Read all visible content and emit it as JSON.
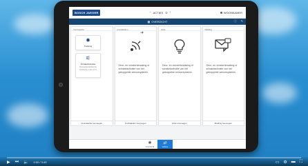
{
  "app": {
    "logo": "BOSCH JAEGER",
    "nav_title": "ACTIES",
    "nav_badge": "②",
    "user": "WOONKAMER"
  },
  "header": {
    "title": "OVERZICHT"
  },
  "columns": [
    {
      "head": "Voorwaarde",
      "tile1_label": "Trekking",
      "tile2_label": "Schakelactivatie",
      "tile2_sub": "Bewegingsactiviteit bij lichtsterkte onder 10 lx"
    },
    {
      "head": "Inschakelen",
      "desc": "Deur- en vensterbewaking of schakelactivatie van het gekoppelde sensorsysteem."
    },
    {
      "head": "Actie",
      "desc": "Deur- en vensterbewaking of schakelactivatie van het gekoppelde sensorsysteem."
    },
    {
      "head": "Melding",
      "desc": "Deur- en vensterbewaking of schakelactivatie van het gekoppelde sensorsysteem."
    }
  ],
  "bottom_labels": [
    "Voorwaarde toevoegen",
    "Inschakelen toevoegen",
    "Actie toevoegen",
    "Melding toevoegen"
  ],
  "footer_nav": [
    {
      "label": "Overzicht",
      "active": false
    },
    {
      "label": "Acties",
      "active": true
    }
  ],
  "video": {
    "time": "0:00 / 3:49",
    "progress": 0.0
  }
}
